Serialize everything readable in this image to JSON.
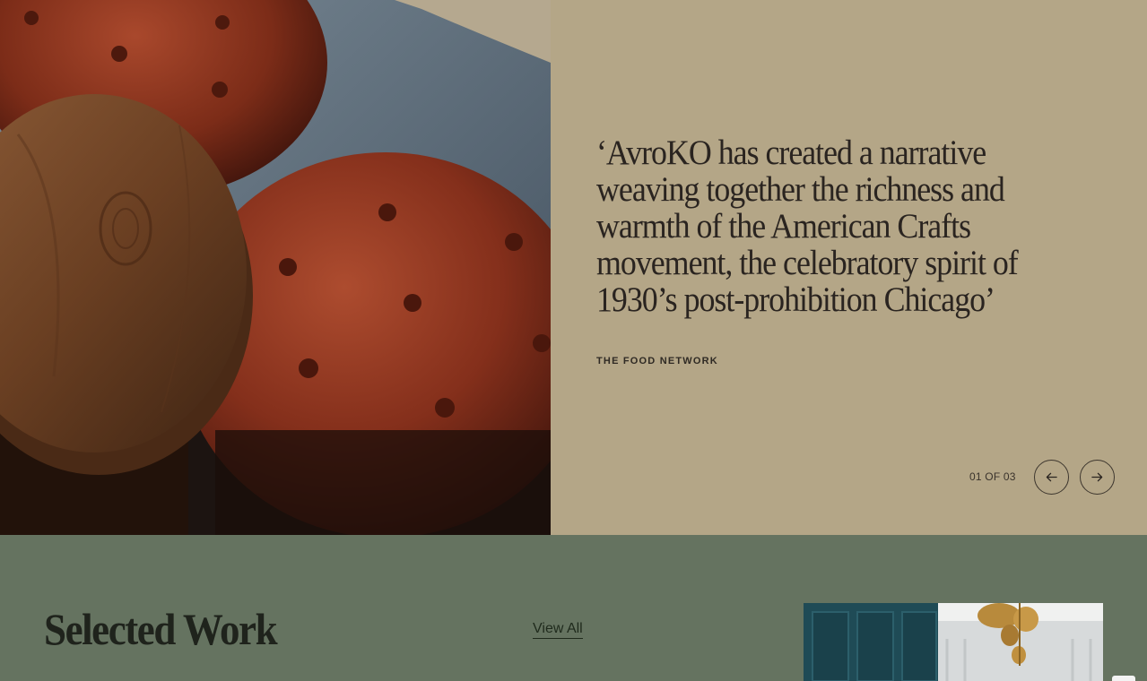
{
  "testimonial": {
    "image_alt": "Velvet buttoned stools beside a walnut side table",
    "quote_lines": [
      "‘AvroKO has created a narrative",
      "weaving together the richness and",
      "warmth of the American Crafts",
      "movement, the celebratory spirit of",
      "1930’s post-prohibition Chicago’"
    ],
    "source": "THE FOOD NETWORK",
    "counter": "01 OF 03",
    "prev_icon": "arrow-left-icon",
    "next_icon": "arrow-right-icon"
  },
  "selected_work": {
    "title": "Selected Work",
    "view_all": "View All",
    "thumb_alt": "Interior with teal panelled walls and brass chandelier"
  },
  "colors": {
    "quote_panel_bg": "#b4a687",
    "work_section_bg": "#657360",
    "text_dark": "#2a2420"
  }
}
